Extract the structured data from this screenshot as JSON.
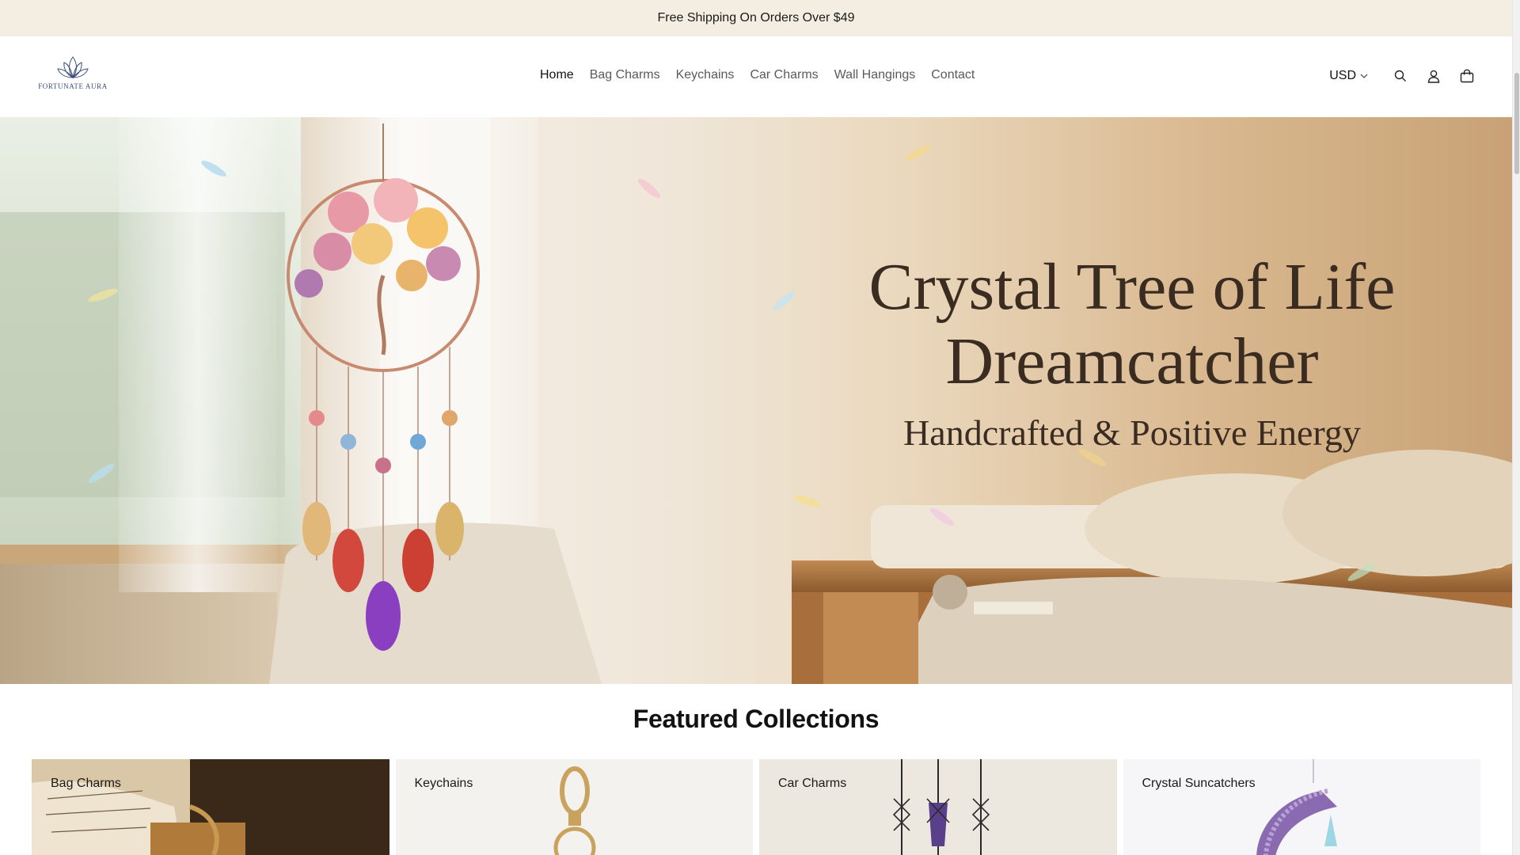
{
  "announcement": {
    "text": "Free Shipping On Orders Over $49"
  },
  "header": {
    "logo_text": "FORTUNATE AURA",
    "nav": [
      {
        "label": "Home",
        "active": true
      },
      {
        "label": "Bag Charms",
        "active": false
      },
      {
        "label": "Keychains",
        "active": false
      },
      {
        "label": "Car Charms",
        "active": false
      },
      {
        "label": "Wall Hangings",
        "active": false
      },
      {
        "label": "Contact",
        "active": false
      }
    ],
    "currency": "USD",
    "icons": [
      "search-icon",
      "account-icon",
      "cart-icon"
    ]
  },
  "hero": {
    "title_line1": "Crystal Tree of Life",
    "title_line2": "Dreamcatcher",
    "subtitle": "Handcrafted & Positive Energy"
  },
  "featured": {
    "heading": "Featured Collections",
    "collections": [
      {
        "label": "Bag Charms"
      },
      {
        "label": "Keychains"
      },
      {
        "label": "Car Charms"
      },
      {
        "label": "Crystal Suncatchers"
      }
    ]
  },
  "colors": {
    "announcement_bg": "#f4eee2",
    "text_primary": "#121212",
    "text_nav": "#5a5a5a",
    "hero_text": "#3b2c22",
    "logo_blue": "#3a4d7a"
  }
}
